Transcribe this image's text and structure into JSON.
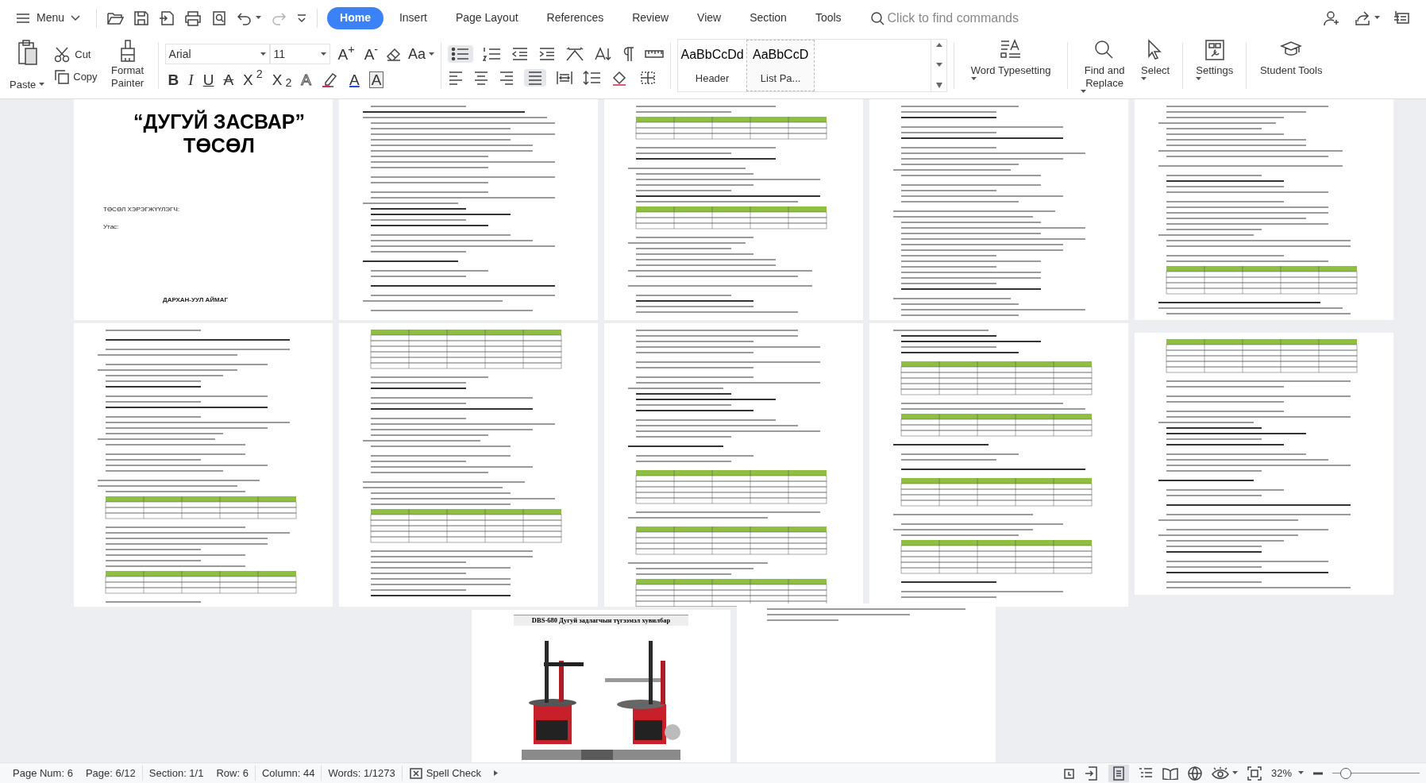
{
  "menu": {
    "label": "Menu"
  },
  "tabs": [
    {
      "label": "Home",
      "selected": true
    },
    {
      "label": "Insert",
      "selected": false
    },
    {
      "label": "Page Layout",
      "selected": false
    },
    {
      "label": "References",
      "selected": false
    },
    {
      "label": "Review",
      "selected": false
    },
    {
      "label": "View",
      "selected": false
    },
    {
      "label": "Section",
      "selected": false
    },
    {
      "label": "Tools",
      "selected": false
    }
  ],
  "search": {
    "placeholder": "Click to find commands"
  },
  "clipboard": {
    "paste": "Paste",
    "cut": "Cut",
    "copy": "Copy",
    "format_painter": "Format Painter"
  },
  "font": {
    "name": "Arial",
    "size": "11",
    "size_buttons": [
      "A$^{+}$",
      "A$^{-}$"
    ],
    "case_button": "Aa",
    "format_buttons": [
      {
        "label": "B",
        "kind": "bold"
      },
      {
        "label": "I",
        "kind": "italic"
      },
      {
        "label": "U",
        "kind": "underline"
      },
      {
        "label": "A",
        "kind": "strike"
      },
      {
        "label": "X$^{2}$",
        "kind": "plain"
      },
      {
        "label": "X$_{2}$",
        "kind": "plain"
      },
      {
        "label": "A",
        "kind": "outline"
      },
      {
        "label": "A",
        "kind": "color"
      },
      {
        "label": "A",
        "kind": "boxed"
      }
    ]
  },
  "styles": [
    {
      "sample": "AaBbCcDd",
      "name": "Header",
      "selected": false
    },
    {
      "sample": "AaBbCcD",
      "name": "List Pa...",
      "selected": true
    }
  ],
  "tools": [
    {
      "label": "Word Typesetting",
      "kind": "typeset",
      "dropdown": true
    },
    {
      "label": "Find and Replace",
      "kind": "find",
      "dropdown": true
    },
    {
      "label": "Select",
      "kind": "select",
      "dropdown": true
    },
    {
      "label": "Settings",
      "kind": "settings",
      "dropdown": true
    },
    {
      "label": "Student Tools",
      "kind": "student",
      "dropdown": false
    }
  ],
  "document": {
    "cover": {
      "title_line_1": "“ДУГУЙ ЗАСВАР”",
      "title_line_2": "ТӨСӨЛ",
      "executor": "ТӨСӨЛ ХЭРЭГЖҮҮЛЭГЧ:",
      "phone": "Утас:",
      "place": "ДАРХАН-УУЛ АЙМАГ"
    },
    "image_page": {
      "caption": "DBS-680 Дугуй задлагчын түгээмэл хувилбар",
      "kind": "picture"
    }
  },
  "status_bar": {
    "items": [
      "Page Num: 6",
      "Page: 6/12",
      "Section: 1/1",
      "Row: 6",
      "Column: 44",
      "Words: 1/1273"
    ],
    "spell_check": "Spell Check",
    "zoom": "32%",
    "zoom_slider": {
      "level": 0.15
    }
  }
}
